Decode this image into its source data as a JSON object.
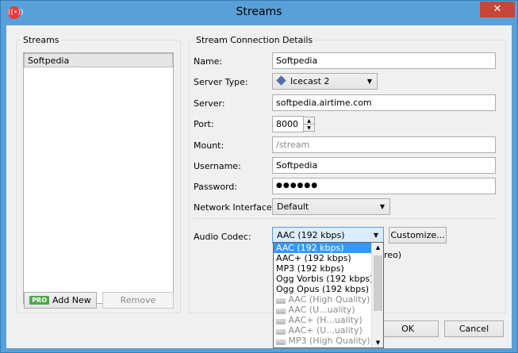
{
  "window": {
    "title": "Streams",
    "app_icon": "radio-signal-icon",
    "close_label": "✕"
  },
  "streams_panel": {
    "legend": "Streams",
    "items": [
      "Softpedia"
    ],
    "add_button": {
      "badge": "PRO",
      "label": "Add New"
    },
    "remove_button": "Remove"
  },
  "details": {
    "legend": "Stream Connection Details",
    "name_label": "Name:",
    "name_value": "Softpedia",
    "server_type_label": "Server Type:",
    "server_type_value": "Icecast 2",
    "server_label": "Server:",
    "server_value": "softpedia.airtime.com",
    "port_label": "Port:",
    "port_value": "8000",
    "mount_label": "Mount:",
    "mount_placeholder": "/stream",
    "username_label": "Username:",
    "username_value": "Softpedia",
    "password_label": "Password:",
    "password_value": "●●●●●●",
    "network_label": "Network Interface:",
    "network_value": "Default",
    "codec_label": "Audio Codec:",
    "codec_value": "AAC (192 kbps)",
    "customize_button": "Customize...",
    "stereo_fragment": "reo)"
  },
  "codec_dropdown": {
    "items": [
      {
        "label": "AAC (192 kbps)",
        "state": "selected",
        "pro": false
      },
      {
        "label": "AAC+ (192 kbps)",
        "state": "normal",
        "pro": false
      },
      {
        "label": "MP3 (192 kbps)",
        "state": "normal",
        "pro": false
      },
      {
        "label": "Ogg Vorbis (192 kbps)",
        "state": "normal",
        "pro": false
      },
      {
        "label": "Ogg Opus (192 kbps)",
        "state": "normal",
        "pro": false
      },
      {
        "label": "AAC (High Quality)",
        "state": "disabled",
        "pro": true
      },
      {
        "label": "AAC (U...uality)",
        "state": "disabled",
        "pro": true
      },
      {
        "label": "AAC+ (H...uality)",
        "state": "disabled",
        "pro": true
      },
      {
        "label": "AAC+ (U...uality)",
        "state": "disabled",
        "pro": true
      },
      {
        "label": "MP3 (High Quality)",
        "state": "disabled",
        "pro": true
      }
    ],
    "pro_badge": "PRO"
  },
  "footer": {
    "ok": "OK",
    "cancel": "Cancel"
  }
}
